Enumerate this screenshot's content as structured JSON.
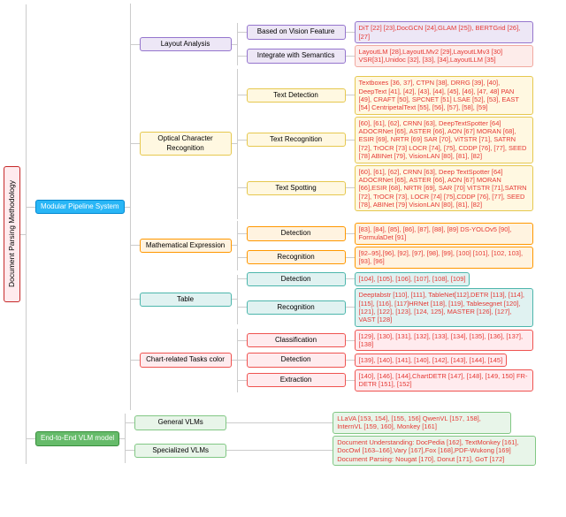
{
  "root": "Document Parsing Methodology",
  "l1": {
    "mps": "Modular Pipeline System",
    "vlm": "End-to-End VLM model"
  },
  "layout": {
    "label": "Layout Analysis",
    "vision": {
      "label": "Based on Vision Feature",
      "text": "DiT [22] [23],DocGCN [24],GLAM [25]), BERTGrid [26], [27]"
    },
    "sem": {
      "label": "Integrate with Semantics",
      "text": "LayoutLM [28],LayoutLMv2 [29],LayoutLMv3 [30] VSR[31],Unidoc [32], [33], [34],LayoutLLM [35]"
    }
  },
  "ocr": {
    "label": "Optical Character Recognition",
    "det": {
      "label": "Text Detection",
      "text": "Textboxes [36, 37], CTPN [38], DRRG [39], [40], DeepText [41], [42], [43], [44], [45], [46], [47, 48] PAN [49], CRAFT [50], SPCNET [51] LSAE [52], [53], EAST [54] CentripetalText [55], [56], [57], [58], [59]"
    },
    "rec": {
      "label": "Text Recognition",
      "text": "[60], [61], [62], CRNN [63], DeepTextSpotter [64] ADOCRNet [65], ASTER [66], AON [67] MORAN [68], ESIR [69], NRTR [69] SAR [70], ViTSTR [71], SATRN [72], TrOCR [73] LOCR [74], [75], CDDP [76], [77], SEED [78] ABINet [79], VisionLAN [80], [81], [82]"
    },
    "spot": {
      "label": "Text Spotting",
      "text": "[60], [61], [62], CRNN [63], Deep TextSpotter [64] ADOCRNet [65], ASTER [66], AON [67] MORAN [66],ESIR [68], NRTR [69], SAR [70] ViTSTR [71],SATRN [72], TrOCR [73], LOCR [74] [75],CDDP [76], [77], SEED [78], ABINet [79] VisionLAN [80], [81], [82]"
    }
  },
  "math": {
    "label": "Mathematical Expression",
    "det": {
      "label": "Detection",
      "text": "[83], [84], [85], [86], [87], [88], [89] DS-YOLOv5 [90], FormulaDet [91]"
    },
    "rec": {
      "label": "Recognition",
      "text": "[92–95],[96], [92], [97], [98], [99], [100] [101], [102, 103], [93], [96]"
    }
  },
  "table": {
    "label": "Table",
    "det": {
      "label": "Detection",
      "text": "[104], [105], [106], [107], [108], [109]"
    },
    "rec": {
      "label": "Recognition",
      "text": "Deeptabstr [110], [111], TableNet[112],DETR [113], [114], [115], [116], [117]HRNet [118], [119], Tablesegnet [120], [121], [122], [123], [124, 125], MASTER [126], [127], VAST [128]"
    }
  },
  "chart": {
    "label": "Chart-related Tasks color",
    "cls": {
      "label": "Classification",
      "text": "[129], [130], [131], [132], [133], [134], [135], [136], [137], [138]"
    },
    "det": {
      "label": "Detection",
      "text": "[139], [140], [141], [140], [142], [143], [144], [145]"
    },
    "ext": {
      "label": "Extraction",
      "text": "[140], [146], [144],ChartDETR [147], [148], [149, 150] FR-DETR  [151], [152]"
    }
  },
  "vlms": {
    "gen": {
      "label": "General VLMs",
      "text": "LLaVA [153, 154], [155, 156] QwenVL [157, 158], InternVL [159, 160], Monkey [161]"
    },
    "spec": {
      "label": "Specialized VLMs",
      "text": "Document Understanding:  DocPedia [162], TextMonkey [161], DocOwl [163–166],Vary [167],Fox [168],PDF-Wukong [169] Document Parsing: Nougat [170], Donut [171], GoT [172]"
    }
  }
}
